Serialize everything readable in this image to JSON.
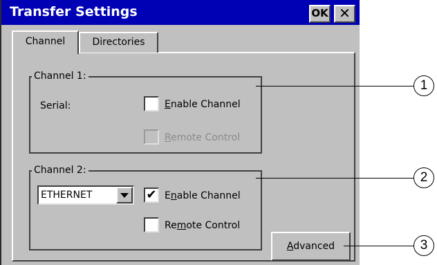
{
  "window": {
    "title": "Transfer Settings",
    "ok_label": "OK",
    "close_label": "✕"
  },
  "tabs": [
    {
      "label": "Channel",
      "active": true
    },
    {
      "label": "Directories",
      "active": false
    }
  ],
  "channel1": {
    "legend": "Channel 1:",
    "serial_label": "Serial:",
    "enable_channel": {
      "pre": "",
      "accel": "E",
      "post": "nable Channel",
      "checked": false
    },
    "remote_control": {
      "pre": "",
      "accel": "R",
      "post": "emote Control",
      "checked": false,
      "disabled": true
    }
  },
  "channel2": {
    "legend": "Channel 2:",
    "protocol_value": "ETHERNET",
    "enable_channel": {
      "pre": "E",
      "accel": "n",
      "post": "able Channel",
      "checked": true,
      "check_mark": "✔"
    },
    "remote_control": {
      "pre": "Re",
      "accel": "m",
      "post": "ote Control",
      "checked": false
    }
  },
  "advanced_button": {
    "pre": "",
    "accel": "A",
    "post": "dvanced"
  },
  "callouts": [
    "1",
    "2",
    "3"
  ]
}
